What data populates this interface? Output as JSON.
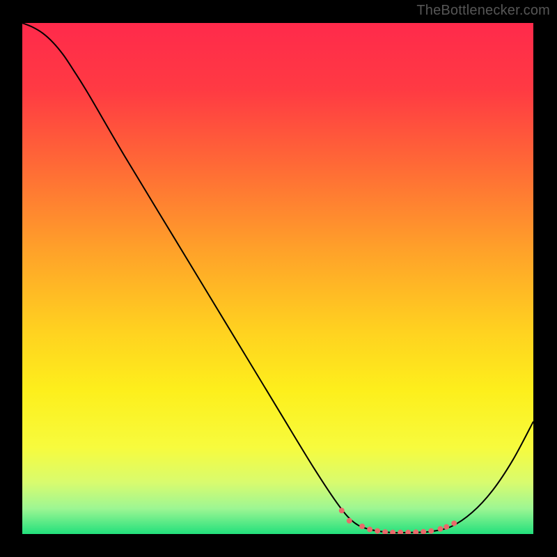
{
  "watermark": "TheBottlenecker.com",
  "chart_data": {
    "type": "line",
    "title": "",
    "xlabel": "",
    "ylabel": "",
    "xlim": [
      0,
      100
    ],
    "ylim": [
      0,
      100
    ],
    "background": {
      "type": "vertical_gradient",
      "stops": [
        {
          "pos": 0.0,
          "color": "#ff2a4b"
        },
        {
          "pos": 0.13,
          "color": "#ff3a43"
        },
        {
          "pos": 0.28,
          "color": "#ff6a36"
        },
        {
          "pos": 0.45,
          "color": "#ffa329"
        },
        {
          "pos": 0.6,
          "color": "#ffd120"
        },
        {
          "pos": 0.72,
          "color": "#fdef1c"
        },
        {
          "pos": 0.83,
          "color": "#f7fb3d"
        },
        {
          "pos": 0.9,
          "color": "#d8fb6f"
        },
        {
          "pos": 0.95,
          "color": "#9df693"
        },
        {
          "pos": 1.0,
          "color": "#22e07c"
        }
      ]
    },
    "series": [
      {
        "name": "curve",
        "stroke": "#000000",
        "stroke_width": 2,
        "x": [
          0.0,
          2.0,
          4.0,
          6.0,
          8.0,
          10.0,
          13.0,
          20.0,
          30.0,
          40.0,
          50.0,
          57.0,
          62.0,
          65.0,
          68.0,
          72.0,
          76.0,
          80.0,
          84.0,
          88.0,
          92.0,
          96.0,
          100.0
        ],
        "y": [
          100.0,
          99.2,
          98.0,
          96.2,
          93.8,
          90.8,
          86.0,
          74.0,
          57.5,
          41.0,
          24.5,
          13.0,
          5.5,
          2.2,
          0.9,
          0.3,
          0.3,
          0.5,
          1.5,
          4.2,
          8.5,
          14.5,
          22.0
        ]
      }
    ],
    "markers": {
      "name": "flat_region_points",
      "color": "#e96a6a",
      "radius": 4,
      "x": [
        62.5,
        64.0,
        66.5,
        68.0,
        69.5,
        71.0,
        72.5,
        74.0,
        75.5,
        77.0,
        78.5,
        80.0,
        81.8,
        83.0,
        84.5
      ],
      "y": [
        4.6,
        2.6,
        1.5,
        0.9,
        0.6,
        0.4,
        0.3,
        0.3,
        0.3,
        0.35,
        0.45,
        0.6,
        1.0,
        1.4,
        2.1
      ]
    }
  }
}
